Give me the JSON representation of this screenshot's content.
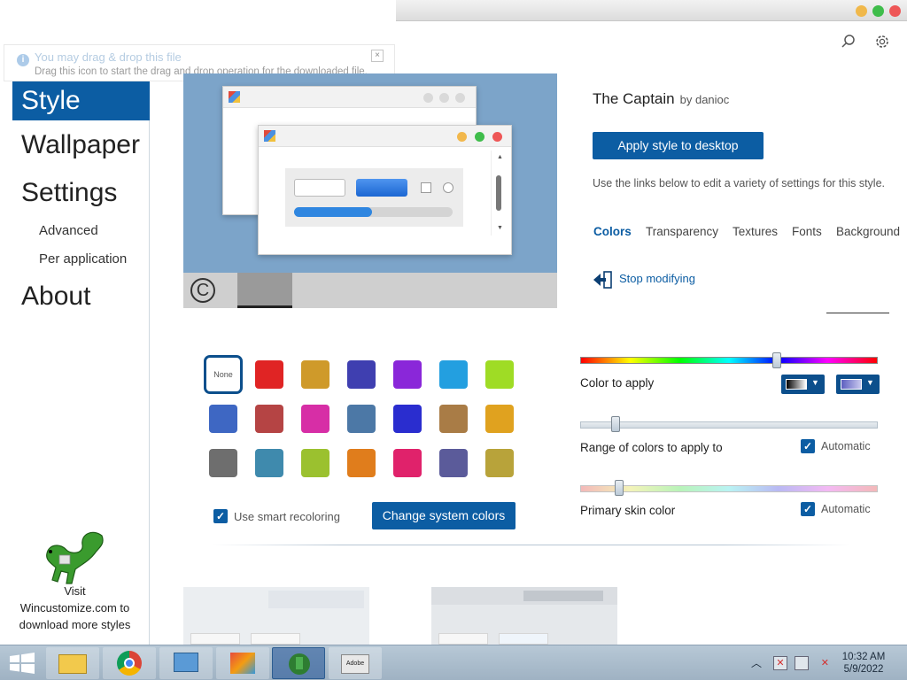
{
  "tooltip": {
    "title": "You may drag & drop this file",
    "body": "Drag this icon to start the drag and drop operation for the downloaded file.",
    "close": "×"
  },
  "sidebar": {
    "items": [
      {
        "label": "Style"
      },
      {
        "label": "Wallpaper"
      },
      {
        "label": "Settings"
      },
      {
        "label": "Advanced"
      },
      {
        "label": "Per application"
      },
      {
        "label": "About"
      }
    ],
    "visit_line1": "Visit",
    "visit_line2": "Wincustomize.com to",
    "visit_line3": "download more styles"
  },
  "style": {
    "name": "The Captain",
    "author": "by danioc",
    "apply_button": "Apply style to desktop",
    "description": "Use the links below to edit a variety of settings for this style.",
    "tabs": [
      "Colors",
      "Transparency",
      "Textures",
      "Fonts",
      "Background"
    ],
    "stop_modifying": "Stop modifying"
  },
  "swatches": {
    "none_label": "None",
    "colors": [
      [
        "#e02424",
        "#cf9a2a",
        "#3f3fb0",
        "#8a27d9",
        "#239fe0",
        "#9fdc25"
      ],
      [
        "#3e67c3",
        "#b54444",
        "#d72ea6",
        "#4c78a6",
        "#2a2dcf",
        "#a97c46",
        "#e0a21f"
      ],
      [
        "#6e6e6e",
        "#3f8aad",
        "#9bc12f",
        "#e07d1c",
        "#e0226b",
        "#5b5b9a",
        "#b8a33a"
      ]
    ],
    "smart_recoloring": "Use smart recoloring",
    "change_system_colors": "Change system colors"
  },
  "color_panel": {
    "color_to_apply": "Color to apply",
    "range_label": "Range of colors to apply to",
    "primary_skin": "Primary skin color",
    "automatic": "Automatic",
    "hue_fraction": 0.66,
    "range_fraction": 0.12,
    "skin_fraction": 0.13
  },
  "accent": "#0c5da3",
  "clock": {
    "time": "10:32 AM",
    "date": "5/9/2022"
  },
  "taskbar": {
    "items": [
      "start-button",
      "file-explorer-icon",
      "chrome-icon",
      "control-panel-icon",
      "folders-icon",
      "download-manager-icon",
      "adobe-icon"
    ],
    "adobe_label": "Adobe"
  }
}
